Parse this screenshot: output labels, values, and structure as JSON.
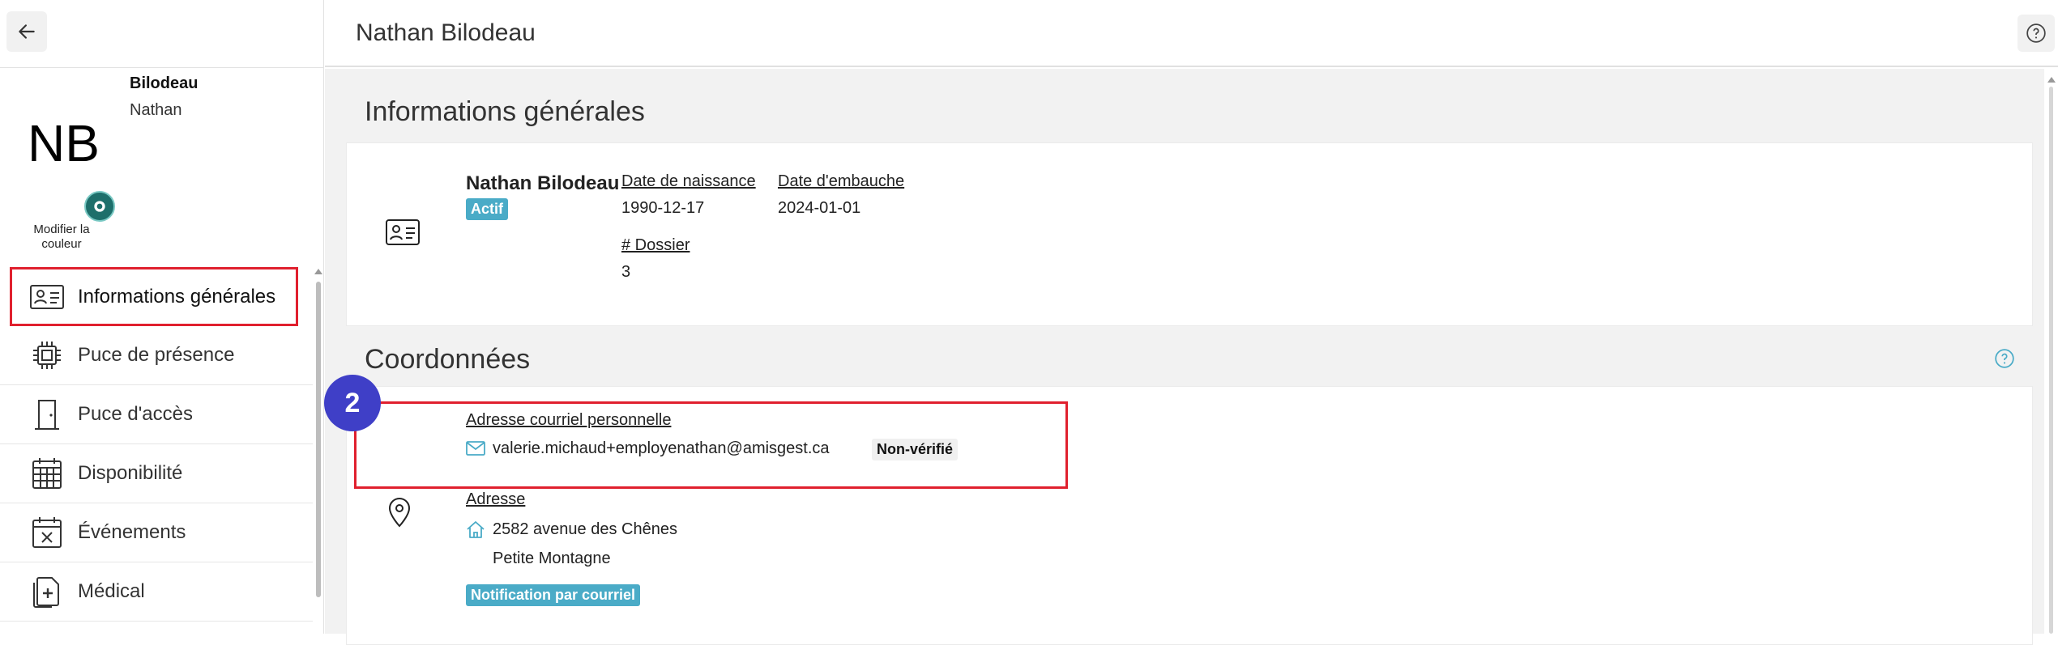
{
  "sidebar": {
    "profile": {
      "lastname": "Bilodeau",
      "firstname": "Nathan",
      "initials": "NB",
      "color_label": "Modifier la couleur"
    },
    "items": [
      {
        "label": "Informations générales",
        "icon": "id-card-icon",
        "active": true
      },
      {
        "label": "Puce de présence",
        "icon": "chip-icon"
      },
      {
        "label": "Puce d'accès",
        "icon": "door-icon"
      },
      {
        "label": "Disponibilité",
        "icon": "calendar-grid-icon"
      },
      {
        "label": "Événements",
        "icon": "calendar-x-icon"
      },
      {
        "label": "Médical",
        "icon": "medical-file-icon"
      }
    ]
  },
  "header": {
    "title": "Nathan Bilodeau"
  },
  "general": {
    "section_title": "Informations générales",
    "name": "Nathan Bilodeau",
    "status": "Actif",
    "birth_label": "Date de naissance",
    "birth_value": "1990-12-17",
    "hire_label": "Date d'embauche",
    "hire_value": "2024-01-01",
    "file_label": "# Dossier",
    "file_value": "3"
  },
  "contact": {
    "section_title": "Coordonnées",
    "email_label": "Adresse courriel personnelle",
    "email_value": "valerie.michaud+employenathan@amisgest.ca",
    "email_status": "Non-vérifié",
    "address_label": "Adresse",
    "address_line1": "2582 avenue des Chênes",
    "address_line2": "Petite Montagne",
    "notification_badge": "Notification par courriel"
  },
  "annotation": {
    "step": "2"
  },
  "colors": {
    "accent": "#4aabc7",
    "highlight": "#e0202e",
    "step_badge": "#3f3fc7"
  }
}
